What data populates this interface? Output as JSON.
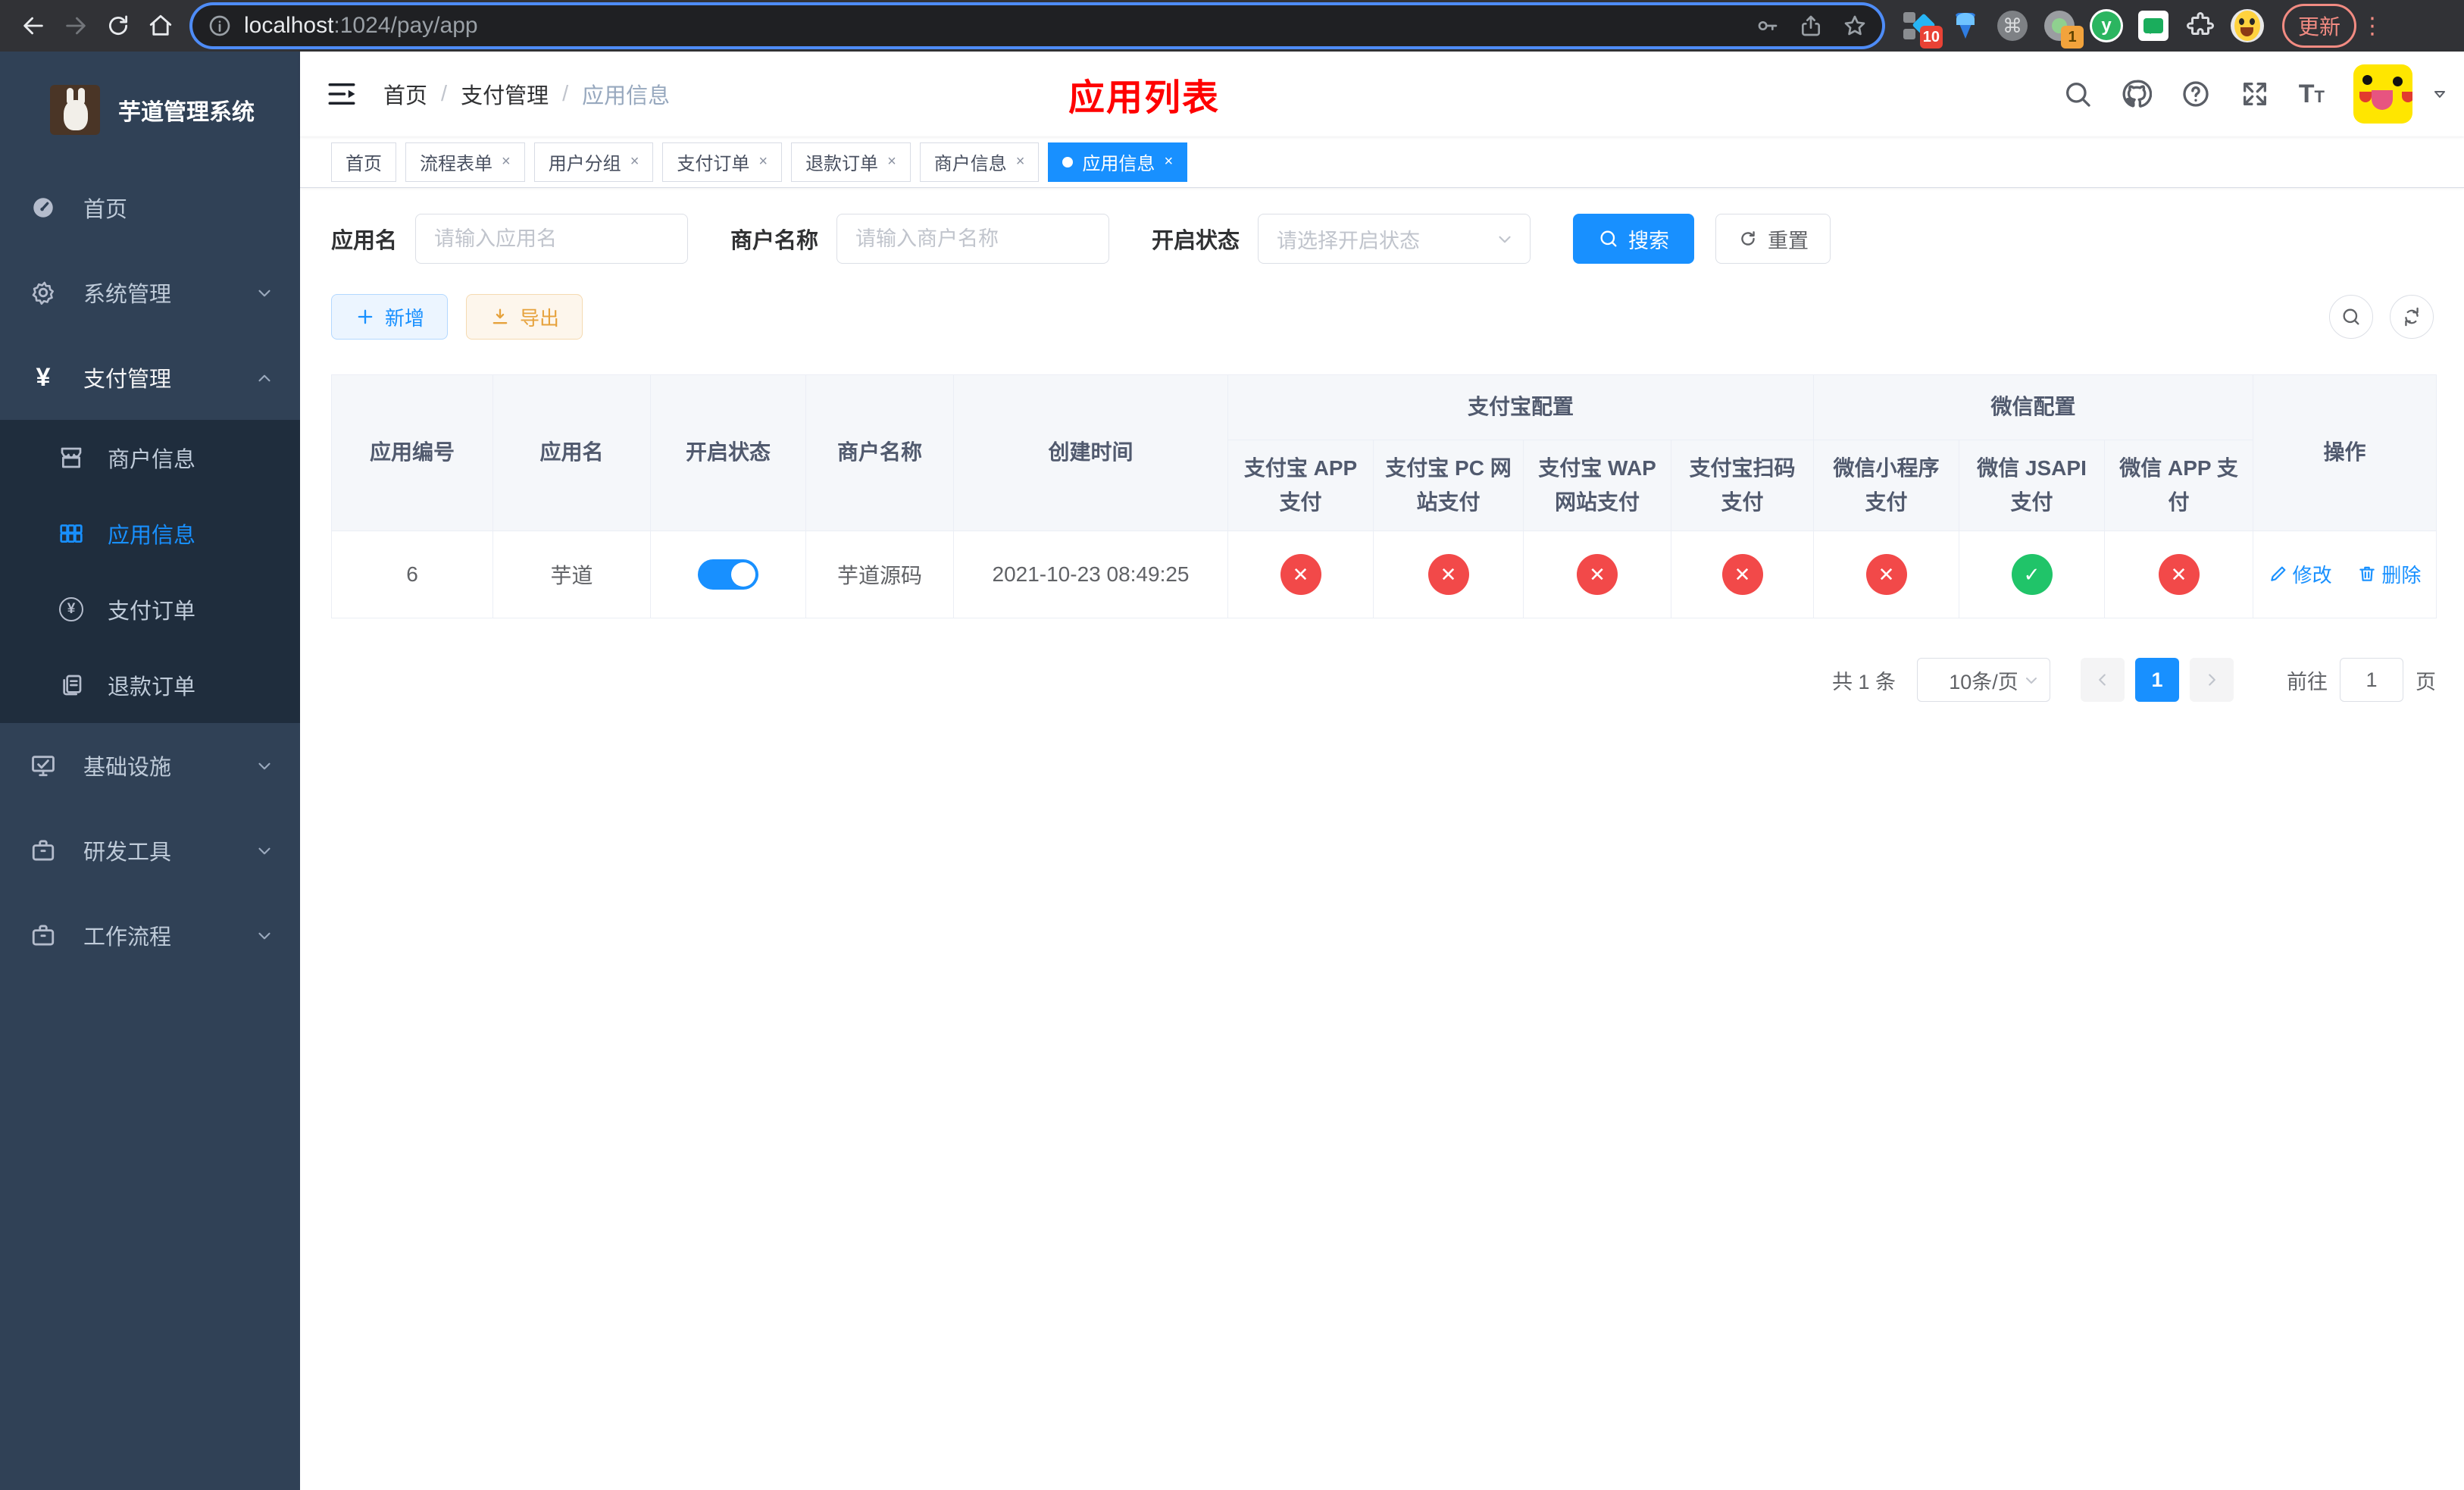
{
  "browser": {
    "url_host": "localhost",
    "url_rest": ":1024/pay/app",
    "update_label": "更新",
    "menu_dots": "⋮",
    "ext_badge_blue": "10",
    "ext_badge_circle": "1",
    "ext_y_letter": "y",
    "ext_cmd": "⌘"
  },
  "sidebar": {
    "title": "芋道管理系统",
    "home": "首页",
    "system": "系统管理",
    "pay": "支付管理",
    "merchant": "商户信息",
    "app": "应用信息",
    "pay_order": "支付订单",
    "refund_order": "退款订单",
    "infra": "基础设施",
    "devtool": "研发工具",
    "workflow": "工作流程",
    "yen": "¥"
  },
  "navbar": {
    "breadcrumb": [
      "首页",
      "支付管理",
      "应用信息"
    ],
    "separator": "/",
    "page_title": "应用列表"
  },
  "tabs": [
    {
      "label": "首页"
    },
    {
      "label": "流程表单"
    },
    {
      "label": "用户分组"
    },
    {
      "label": "支付订单"
    },
    {
      "label": "退款订单"
    },
    {
      "label": "商户信息"
    },
    {
      "label": "应用信息"
    }
  ],
  "tab_close": "×",
  "filters": {
    "app_name_label": "应用名",
    "app_name_placeholder": "请输入应用名",
    "merchant_label": "商户名称",
    "merchant_placeholder": "请输入商户名称",
    "status_label": "开启状态",
    "status_placeholder": "请选择开启状态",
    "search_label": "搜索",
    "reset_label": "重置"
  },
  "toolbar": {
    "add_label": "新增",
    "export_label": "导出"
  },
  "table": {
    "col_id": "应用编号",
    "col_name": "应用名",
    "col_status": "开启状态",
    "col_merchant": "商户名称",
    "col_created": "创建时间",
    "group_alipay": "支付宝配置",
    "group_wechat": "微信配置",
    "col_op": "操作",
    "alipay_cols": [
      "支付宝 APP 支付",
      "支付宝 PC 网站支付",
      "支付宝 WAP 网站支付",
      "支付宝扫码支付"
    ],
    "wechat_cols": [
      "微信小程序支付",
      "微信 JSAPI 支付",
      "微信 APP 支付"
    ],
    "row": {
      "id": "6",
      "name": "芋道",
      "enabled": true,
      "merchant": "芋道源码",
      "created": "2021-10-23 08:49:25",
      "alipay_statuses": [
        "no",
        "no",
        "no",
        "no"
      ],
      "wechat_statuses": [
        "no",
        "yes",
        "no"
      ],
      "edit_label": "修改",
      "delete_label": "删除"
    }
  },
  "pagination": {
    "total": "共 1 条",
    "page_size": "10条/页",
    "page": "1",
    "goto_prefix": "前往",
    "goto_value": "1",
    "goto_suffix": "页"
  },
  "colors": {
    "accent": "#1890ff",
    "success": "#20c469",
    "danger": "#f24949",
    "sidebar_bg": "#304156",
    "submenu_bg": "#1f2d3d"
  }
}
